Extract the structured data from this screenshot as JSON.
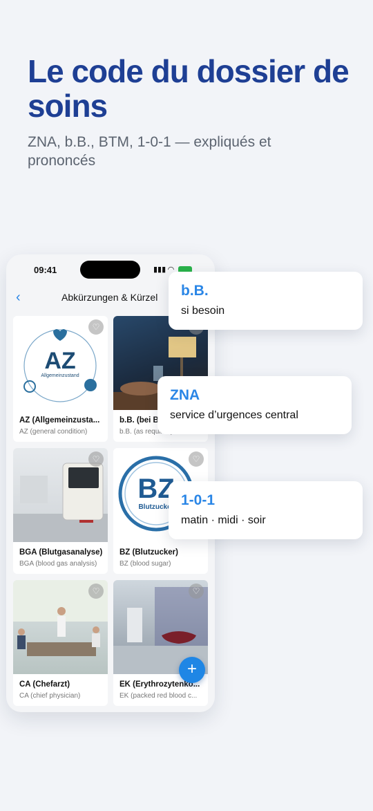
{
  "hero": {
    "title": "Le code du dossier de soins",
    "subtitle": "ZNA, b.B., BTM, 1-0-1 — expliqués et prononcés"
  },
  "phone": {
    "status_time": "09:41",
    "nav_title": "Abkürzungen & Kürzel",
    "cards": [
      {
        "title": "AZ (Allgemeinzusta...",
        "subtitle": "AZ (general condition)",
        "logo_text": "AZ",
        "logo_caption": "Allgemeinzustand"
      },
      {
        "title": "b.B. (bei Bedarf)",
        "subtitle": "b.B. (as required)"
      },
      {
        "title": "BGA (Blutgasanalyse)",
        "subtitle": "BGA (blood gas analysis)"
      },
      {
        "title": "BZ (Blutzucker)",
        "subtitle": "BZ (blood sugar)",
        "logo_text": "BZ",
        "logo_caption": "Blutzucker"
      },
      {
        "title": "CA (Chefarzt)",
        "subtitle": "CA (chief physician)"
      },
      {
        "title": "EK (Erythrozytenko...",
        "subtitle": "EK (packed red blood c..."
      }
    ],
    "fab_label": "+"
  },
  "tooltips": [
    {
      "abbr": "b.B.",
      "meaning": "si besoin"
    },
    {
      "abbr": "ZNA",
      "meaning": "service d’urgences central"
    },
    {
      "abbr": "1-0-1",
      "meaning": "matin · midi · soir"
    }
  ],
  "colors": {
    "headline": "#1e3f94",
    "accent": "#2a86e6",
    "background": "#f2f4f8"
  }
}
